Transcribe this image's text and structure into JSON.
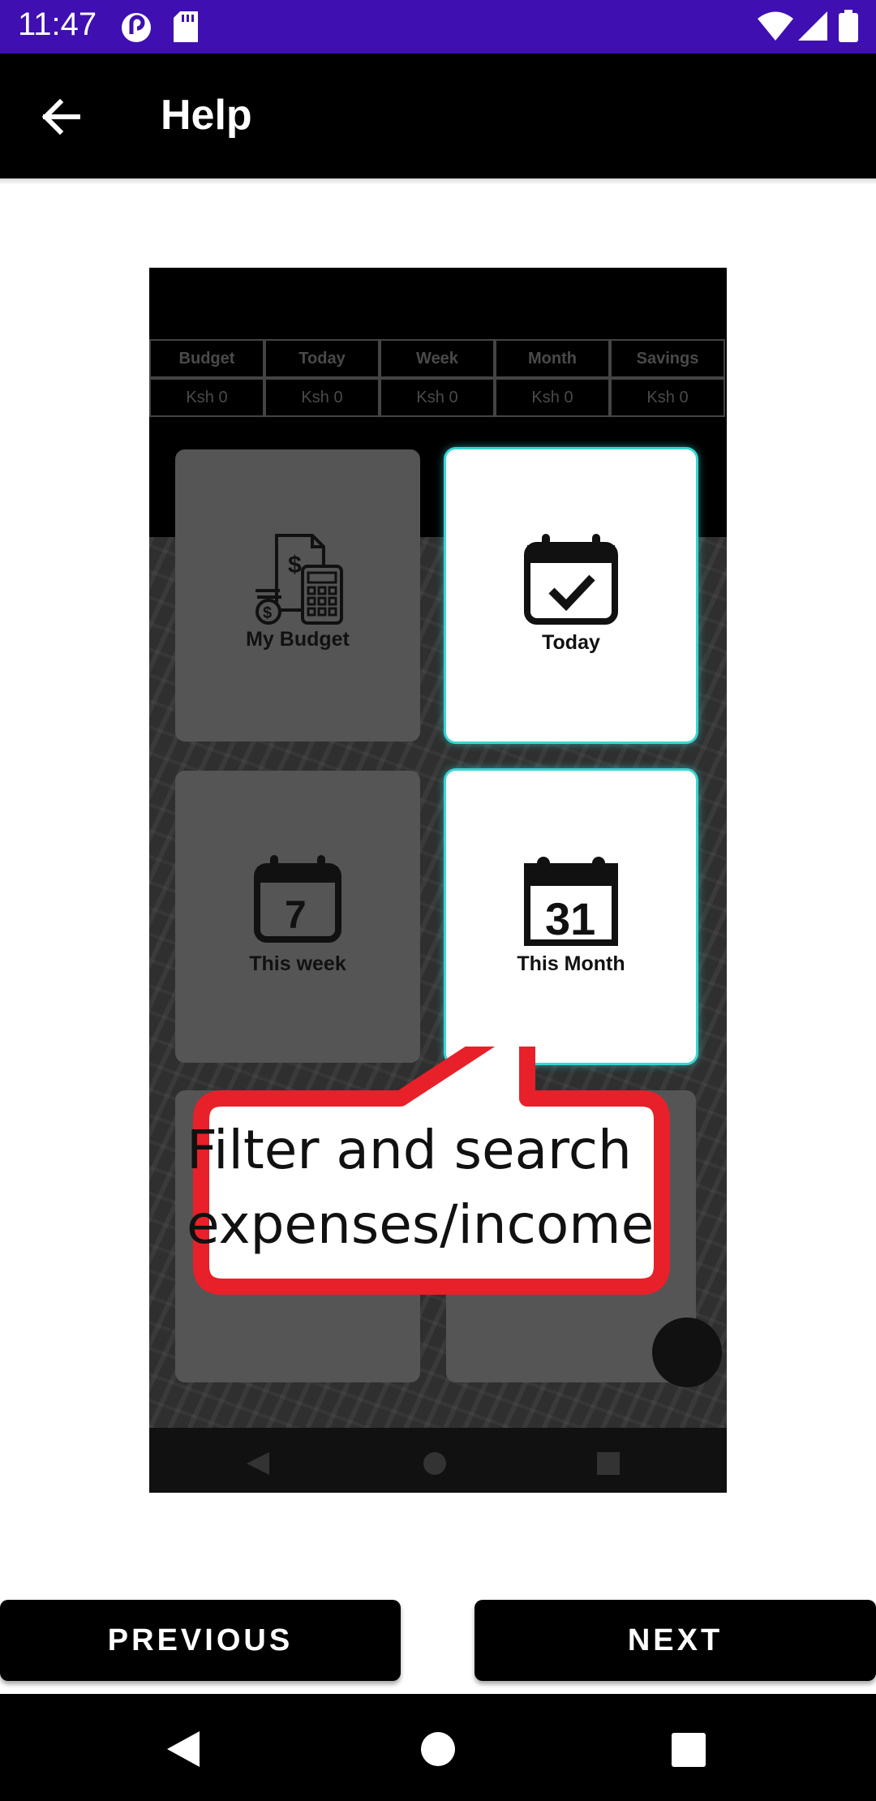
{
  "status_bar": {
    "time": "11:47",
    "icons": [
      "pocket-casts-icon",
      "sd-card-icon",
      "wifi-icon",
      "signal-icon",
      "battery-icon"
    ]
  },
  "app_bar": {
    "title": "Help",
    "back_icon": "arrow-left-icon"
  },
  "help_image": {
    "summary_table": {
      "headers": [
        "Budget",
        "Today",
        "Week",
        "Month",
        "Savings"
      ],
      "values": [
        "Ksh 0",
        "Ksh 0",
        "Ksh 0",
        "Ksh 0",
        "Ksh 0"
      ]
    },
    "cards": [
      {
        "label": "My Budget",
        "icon": "budget-calculator-icon",
        "highlighted": false
      },
      {
        "label": "Today",
        "icon": "calendar-check-icon",
        "highlighted": true
      },
      {
        "label": "This week",
        "icon": "calendar-7-icon",
        "highlighted": false
      },
      {
        "label": "This Month",
        "icon": "calendar-31-icon",
        "highlighted": true
      }
    ],
    "calendar_numbers": {
      "week": "7",
      "month": "31"
    },
    "callout": {
      "line1": "Filter and search",
      "line2": "expenses/income",
      "border_color": "#e8202a"
    },
    "highlight_color": "#38d6d2"
  },
  "buttons": {
    "previous": "PREVIOUS",
    "next": "NEXT"
  },
  "colors": {
    "status_bar": "#3f0fb1",
    "app_bar": "#000000",
    "button": "#000000"
  }
}
